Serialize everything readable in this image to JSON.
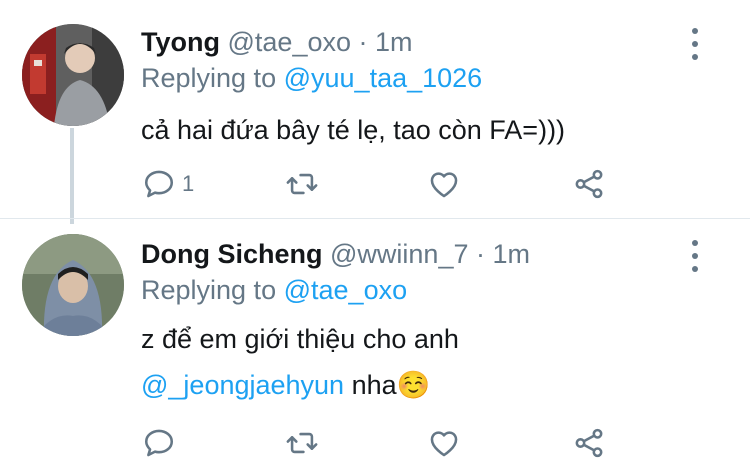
{
  "tweets": [
    {
      "display_name": "Tyong",
      "handle": "@tae_oxo",
      "time": "1m",
      "replying_label": "Replying to",
      "replying_to": "@yuu_taa_1026",
      "text_lines": [
        "cả hai đứa bây té lẹ, tao còn FA=)))"
      ],
      "reply_count": "1",
      "avatar_icon": "profile-photo"
    },
    {
      "display_name": "Dong Sicheng",
      "handle": "@wwiinn_7",
      "time": "1m",
      "replying_label": "Replying to",
      "replying_to": "@tae_oxo",
      "text_line_1": "z để em giới thiệu cho anh",
      "text_mention": "@_jeongjaehyun",
      "text_after_mention": " nha☺️",
      "avatar_icon": "profile-photo"
    }
  ],
  "separator": " · ",
  "colors": {
    "accent": "#1da1f2",
    "secondary_text": "#657786",
    "primary_text": "#14171a",
    "thread_line": "#ccd6dd"
  },
  "icons": [
    "reply-icon",
    "retweet-icon",
    "like-icon",
    "share-icon",
    "more-options-icon"
  ]
}
